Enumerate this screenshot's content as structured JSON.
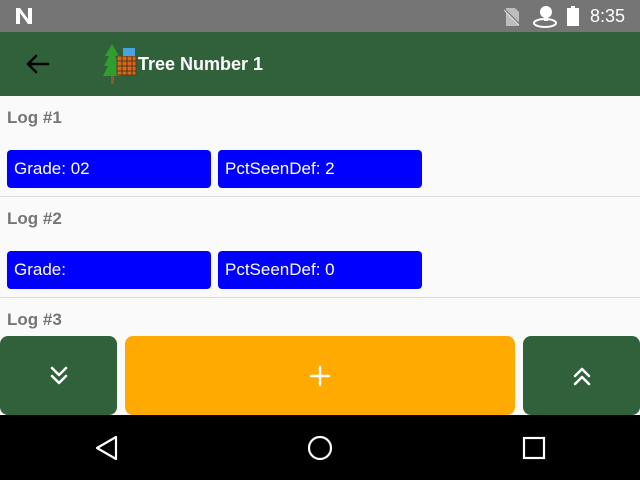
{
  "status_bar": {
    "time": "8:35",
    "icons": [
      "n-notification-icon",
      "no-sim-icon",
      "location-icon",
      "battery-icon"
    ]
  },
  "app_bar": {
    "title": "Tree Number 1",
    "back_icon": "arrow-back-icon",
    "logo_icon": "tree-logo-icon"
  },
  "logs": [
    {
      "title": "Log #1",
      "grade": "Grade: 02",
      "pct": "PctSeenDef: 2"
    },
    {
      "title": "Log #2",
      "grade": "Grade:",
      "pct": "PctSeenDef: 0"
    },
    {
      "title": "Log #3"
    }
  ],
  "actions": {
    "down_icon": "chevron-double-down-icon",
    "add_icon": "plus-icon",
    "up_icon": "chevron-double-up-icon"
  },
  "colors": {
    "primary": "#31613a",
    "accent": "#ffaa00",
    "chip": "#0000ff",
    "status_bar": "#757575"
  }
}
